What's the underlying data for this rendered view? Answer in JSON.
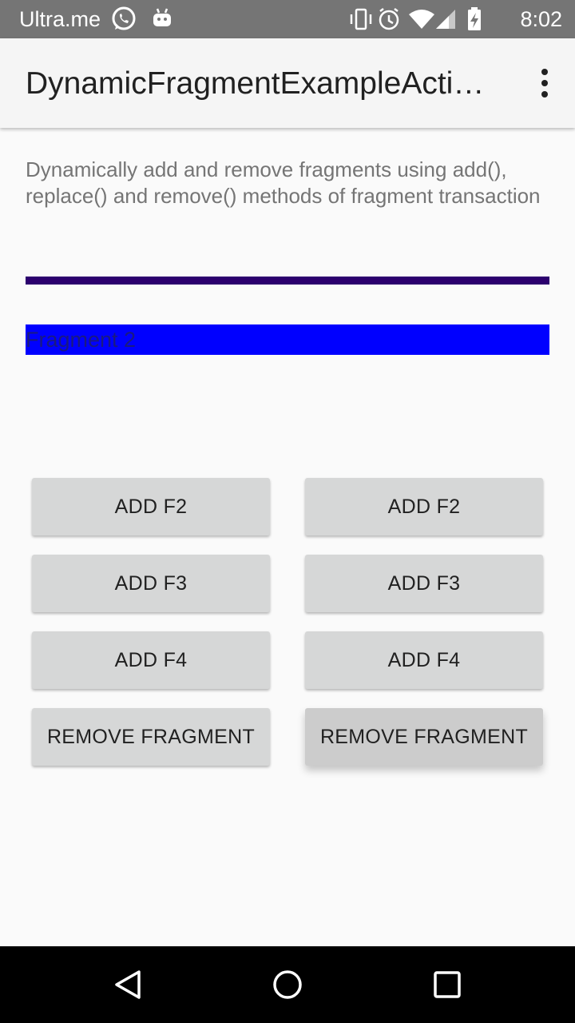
{
  "status_bar": {
    "carrier": "Ultra.me",
    "time": "8:02",
    "icons": [
      "whatsapp-icon",
      "android-icon",
      "vibrate-icon",
      "alarm-icon",
      "wifi-icon",
      "signal-icon",
      "battery-charging-icon"
    ]
  },
  "app_bar": {
    "title": "DynamicFragmentExampleActi…",
    "menu_icon": "more-vert-icon"
  },
  "content": {
    "description": "Dynamically add and remove fragments using add(), replace() and remove() methods of fragment transaction",
    "fragment_label": "Fragment 2"
  },
  "buttons": {
    "left": {
      "add_f2": "ADD F2",
      "add_f3": "ADD F3",
      "add_f4": "ADD F4",
      "remove": "REMOVE FRAGMENT"
    },
    "right": {
      "add_f2": "ADD F2",
      "add_f3": "ADD F3",
      "add_f4": "ADD F4",
      "remove": "REMOVE FRAGMENT"
    }
  },
  "nav_bar": {
    "icons": [
      "back-icon",
      "home-icon",
      "recents-icon"
    ]
  },
  "colors": {
    "status_bar": "#757575",
    "app_bar": "#f5f5f5",
    "divider": "#2c006e",
    "fragment_background": "#0000ff",
    "button": "#d6d7d7",
    "nav_bar": "#000000"
  }
}
